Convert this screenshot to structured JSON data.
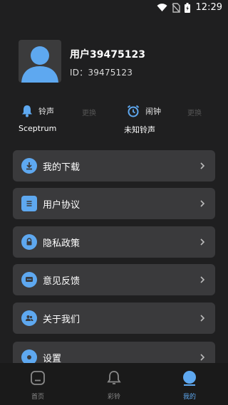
{
  "status": {
    "time": "12:29"
  },
  "profile": {
    "username": "用户39475123",
    "id_label": "ID：39475123"
  },
  "ringtone": {
    "left": {
      "title": "铃声",
      "change": "更换",
      "value": "Sceptrum"
    },
    "right": {
      "title": "闹钟",
      "change": "更换",
      "value": "未知铃声"
    }
  },
  "menu": [
    {
      "label": "我的下载",
      "icon": "download-icon"
    },
    {
      "label": "用户协议",
      "icon": "document-icon"
    },
    {
      "label": "隐私政策",
      "icon": "lock-icon"
    },
    {
      "label": "意见反馈",
      "icon": "chat-icon"
    },
    {
      "label": "关于我们",
      "icon": "people-icon"
    },
    {
      "label": "设置",
      "icon": "settings-icon"
    }
  ],
  "tabs": [
    {
      "label": "首页",
      "icon": "home-icon",
      "active": false
    },
    {
      "label": "彩铃",
      "icon": "bell-icon",
      "active": false
    },
    {
      "label": "我的",
      "icon": "profile-icon",
      "active": true
    }
  ],
  "colors": {
    "accent": "#5ea8f0",
    "background": "#1f1f20",
    "card": "#3a3a3c"
  }
}
